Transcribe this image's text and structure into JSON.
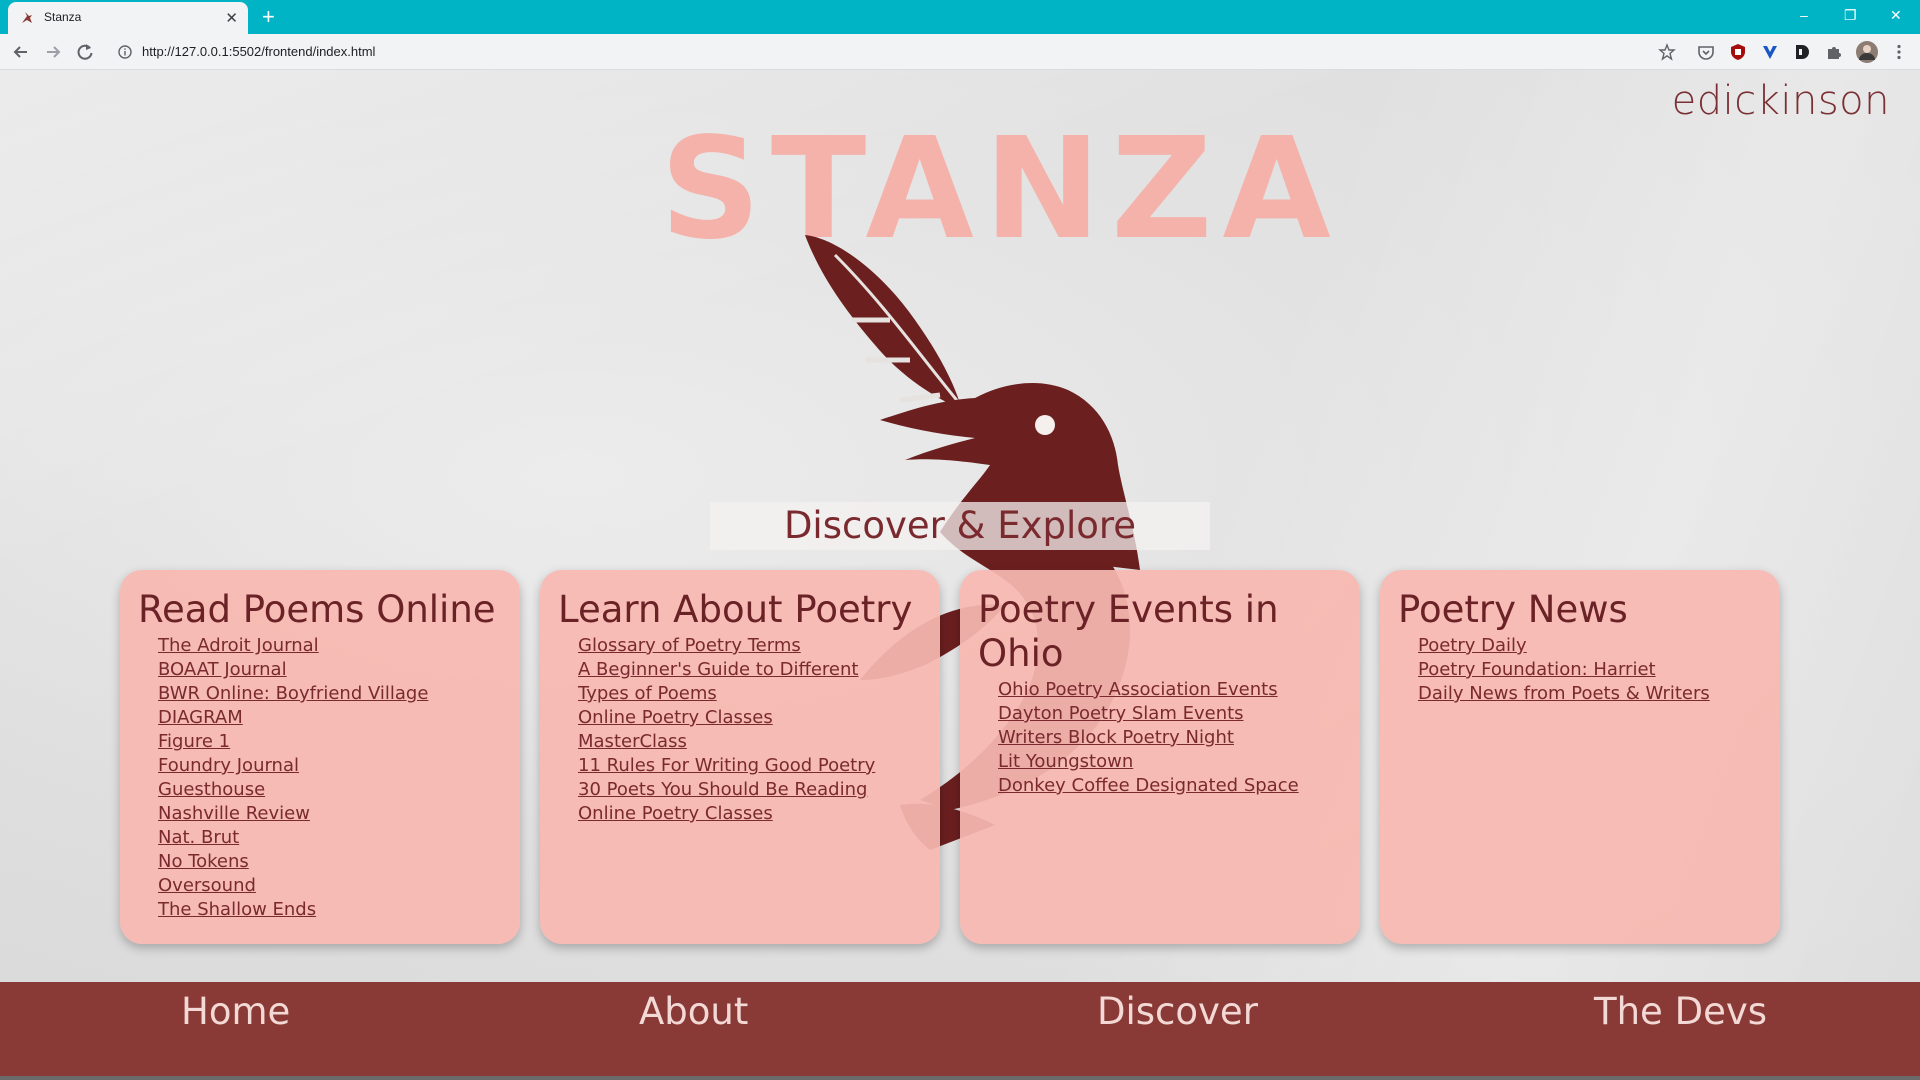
{
  "browser": {
    "tab_title": "Stanza",
    "tab_close": "✕",
    "new_tab": "+",
    "url": "http://127.0.0.1:5502/frontend/index.html",
    "controls": {
      "minimize": "–",
      "restore": "❐",
      "close": "✕"
    },
    "accent_color": "#00b4c5"
  },
  "header": {
    "username": "edickinson",
    "logo_text": "STANZA"
  },
  "banner": {
    "title": "Discover & Explore"
  },
  "cards": [
    {
      "title": "Read Poems Online",
      "links": [
        "The Adroit Journal",
        "BOAAT Journal",
        "BWR Online: Boyfriend Village",
        "DIAGRAM",
        "Figure 1",
        "Foundry Journal",
        "Guesthouse",
        "Nashville Review",
        "Nat. Brut",
        "No Tokens",
        "Oversound",
        "The Shallow Ends"
      ]
    },
    {
      "title": "Learn About Poetry",
      "links": [
        "Glossary of Poetry Terms",
        "A Beginner's Guide to Different Types of Poems",
        "Online Poetry Classes",
        "MasterClass",
        "11 Rules For Writing Good Poetry",
        "30 Poets You Should Be Reading",
        "Online Poetry Classes"
      ]
    },
    {
      "title": "Poetry Events in Ohio",
      "links": [
        "Ohio Poetry Association Events",
        "Dayton Poetry Slam Events",
        "Writers Block Poetry Night",
        "Lit Youngstown",
        "Donkey Coffee Designated Space"
      ]
    },
    {
      "title": "Poetry News",
      "links": [
        "Poetry Daily",
        "Poetry Foundation: Harriet",
        "Daily News from Poets & Writers"
      ]
    }
  ],
  "footer": {
    "home": "Home",
    "about": "About",
    "discover": "Discover",
    "devs": "The Devs"
  },
  "colors": {
    "logo": "#f4b2aa",
    "raven": "#6b1f1f",
    "card": "#f6b8b0",
    "footer": "#8a3a36",
    "text_dark": "#7a2a2e"
  }
}
